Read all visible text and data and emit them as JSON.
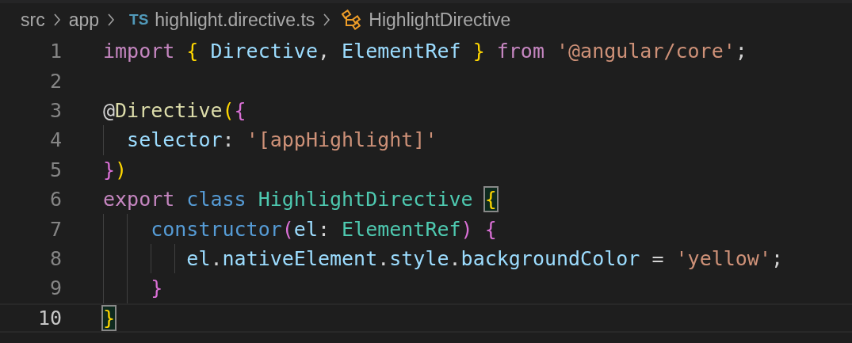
{
  "breadcrumbs": [
    {
      "kind": "folder",
      "label": "src"
    },
    {
      "kind": "folder",
      "label": "app"
    },
    {
      "kind": "file",
      "badge": "TS",
      "label": "highlight.directive.ts"
    },
    {
      "kind": "symbol",
      "label": "HighlightDirective"
    }
  ],
  "editor": {
    "lines": [
      {
        "number": "1",
        "current": false,
        "tokens": [
          {
            "t": "import ",
            "kind": "keyword"
          },
          {
            "t": "{ ",
            "kind": "b1"
          },
          {
            "t": "Directive",
            "kind": "variable"
          },
          {
            "t": ", ",
            "kind": "plain"
          },
          {
            "t": "ElementRef ",
            "kind": "variable"
          },
          {
            "t": "} ",
            "kind": "b1"
          },
          {
            "t": "from ",
            "kind": "keyword"
          },
          {
            "t": "'@angular/core'",
            "kind": "string"
          },
          {
            "t": ";",
            "kind": "plain"
          }
        ]
      },
      {
        "number": "2",
        "current": false
      },
      {
        "number": "3",
        "current": false,
        "tokens": [
          {
            "t": "@",
            "kind": "plain"
          },
          {
            "t": "Directive",
            "kind": "function"
          },
          {
            "t": "(",
            "kind": "b1"
          },
          {
            "t": "{",
            "kind": "b2"
          }
        ]
      },
      {
        "number": "4",
        "current": false,
        "tokens": [
          {
            "t": "  selector",
            "kind": "variable"
          },
          {
            "t": ": ",
            "kind": "plain"
          },
          {
            "t": "'[appHighlight]'",
            "kind": "string"
          }
        ]
      },
      {
        "number": "5",
        "current": false,
        "tokens": [
          {
            "t": "}",
            "kind": "b2"
          },
          {
            "t": ")",
            "kind": "b1"
          }
        ]
      },
      {
        "number": "6",
        "current": false,
        "tokens": [
          {
            "t": "export ",
            "kind": "keyword"
          },
          {
            "t": "class ",
            "kind": "storage"
          },
          {
            "t": "HighlightDirective ",
            "kind": "type"
          },
          {
            "t": "{",
            "kind": "b1",
            "matched": true
          }
        ]
      },
      {
        "number": "7",
        "current": false,
        "tokens": [
          {
            "t": "    constructor",
            "kind": "storage"
          },
          {
            "t": "(",
            "kind": "b2"
          },
          {
            "t": "el",
            "kind": "variable"
          },
          {
            "t": ": ",
            "kind": "plain"
          },
          {
            "t": "ElementRef",
            "kind": "type"
          },
          {
            "t": ") ",
            "kind": "b2"
          },
          {
            "t": "{",
            "kind": "b2"
          }
        ]
      },
      {
        "number": "8",
        "current": false,
        "tokens": [
          {
            "t": "       el",
            "kind": "variable"
          },
          {
            "t": ".",
            "kind": "plain"
          },
          {
            "t": "nativeElement",
            "kind": "variable"
          },
          {
            "t": ".",
            "kind": "plain"
          },
          {
            "t": "style",
            "kind": "variable"
          },
          {
            "t": ".",
            "kind": "plain"
          },
          {
            "t": "backgroundColor",
            "kind": "variable"
          },
          {
            "t": " = ",
            "kind": "plain"
          },
          {
            "t": "'yellow'",
            "kind": "string"
          },
          {
            "t": ";",
            "kind": "plain"
          }
        ]
      },
      {
        "number": "9",
        "current": false,
        "tokens": [
          {
            "t": "    }",
            "kind": "b2"
          }
        ]
      },
      {
        "number": "10",
        "current": true,
        "tokens": [
          {
            "t": "}",
            "kind": "b1",
            "matched": true
          }
        ]
      }
    ]
  }
}
